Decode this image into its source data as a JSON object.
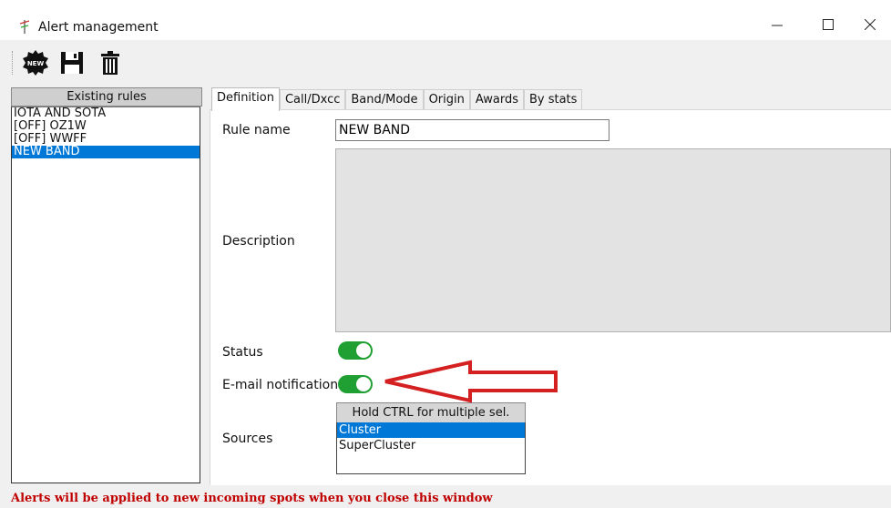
{
  "window": {
    "title": "Alert management"
  },
  "toolbar": {
    "new_badge": "NEW"
  },
  "rules": {
    "header": "Existing rules",
    "items": [
      "IOTA AND SOTA",
      "[OFF] OZ1W",
      "[OFF] WWFF",
      "NEW BAND"
    ],
    "selected_index": 3
  },
  "tabs": [
    "Definition",
    "Call/Dxcc",
    "Band/Mode",
    "Origin",
    "Awards",
    "By stats"
  ],
  "definition": {
    "rule_name_label": "Rule name",
    "rule_name_value": "NEW BAND",
    "description_label": "Description",
    "status_label": "Status",
    "status_on": true,
    "email_label": "E-mail notification",
    "email_on": true,
    "sources_label": "Sources",
    "sources_header": "Hold CTRL for multiple sel.",
    "sources_items": [
      "Cluster",
      "SuperCluster"
    ],
    "sources_selected_index": 0
  },
  "status_bar": {
    "message": "Alerts will be applied to new incoming spots when you close this window"
  },
  "colors": {
    "selection": "#0078d7",
    "toggle_on": "#20a033",
    "annotation_arrow": "#d42020",
    "status_message": "#c00000"
  }
}
